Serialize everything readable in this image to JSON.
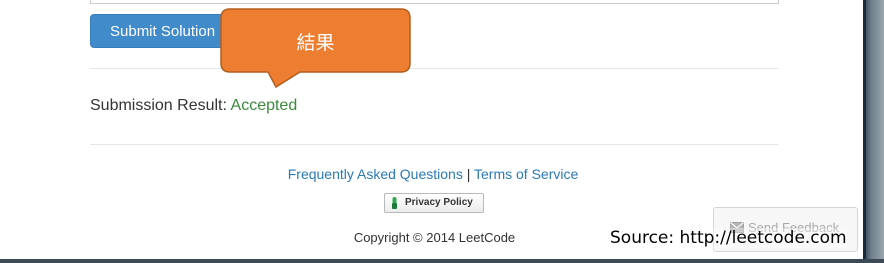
{
  "submit_button": {
    "label": "Submit Solution"
  },
  "callout": {
    "label": "結果",
    "color": "#ed7d31"
  },
  "result": {
    "label": "Submission Result: ",
    "status": "Accepted",
    "status_color": "#3c8a3c"
  },
  "footer": {
    "faq_link": "Frequently Asked Questions",
    "separator": "|",
    "terms_link": "Terms of Service",
    "privacy_button": "Privacy Policy",
    "privacy_icon": "lock-shield-icon",
    "copyright": "Copyright © 2014 LeetCode"
  },
  "feedback": {
    "label": "Send Feedback",
    "icon": "envelope-icon"
  },
  "source_overlay": {
    "text": "Source: http://leetcode.com"
  },
  "colors": {
    "primary_button": "#428bca",
    "link": "#2a7ab8"
  }
}
